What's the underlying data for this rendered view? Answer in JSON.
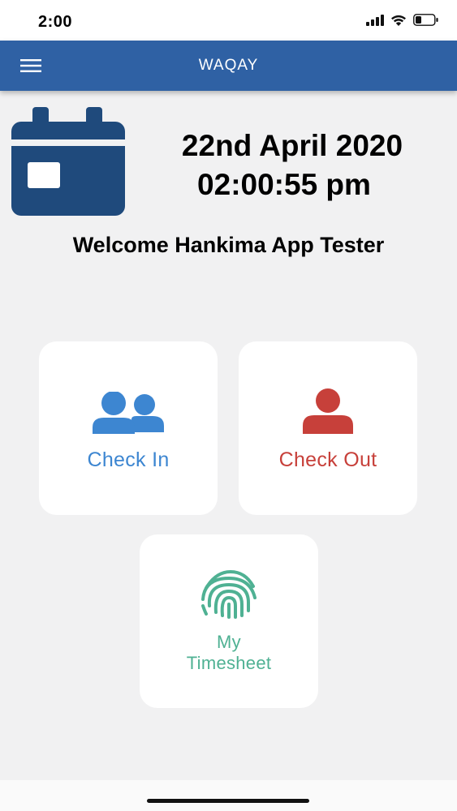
{
  "status_bar": {
    "time": "2:00"
  },
  "navbar": {
    "title": "WAQAY"
  },
  "header": {
    "date": "22nd April 2020",
    "time": "02:00:55 pm",
    "welcome": "Welcome Hankima App Tester"
  },
  "actions": {
    "check_in": "Check In",
    "check_out": "Check Out",
    "timesheet_line1": "My",
    "timesheet_line2": "Timesheet"
  },
  "colors": {
    "navbar": "#2f61a4",
    "calendar": "#1f4a7c",
    "check_in": "#3d86d1",
    "check_out": "#c7403a",
    "timesheet": "#4fb193"
  },
  "icons": {
    "menu": "hamburger-icon",
    "calendar": "calendar-icon",
    "check_in": "users-icon",
    "check_out": "user-icon",
    "timesheet": "fingerprint-icon"
  }
}
